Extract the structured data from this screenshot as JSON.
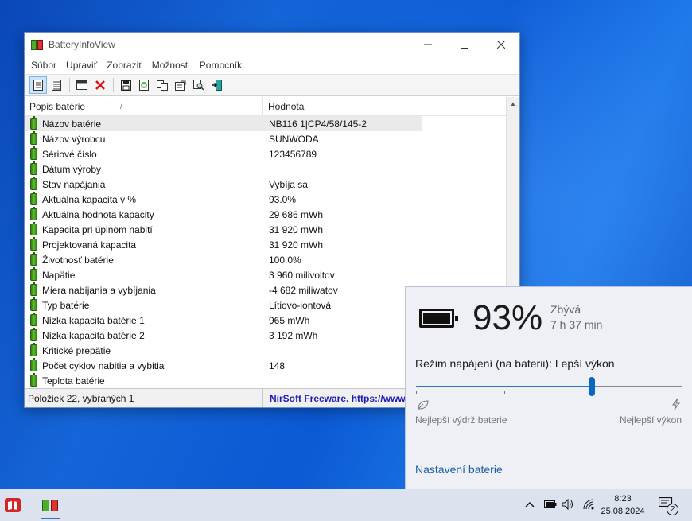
{
  "window": {
    "title": "BatteryInfoView",
    "menu": [
      "Súbor",
      "Upraviť",
      "Zobraziť",
      "Možnosti",
      "Pomocník"
    ],
    "columns": {
      "name": "Popis batérie",
      "value": "Hodnota"
    },
    "rows": [
      {
        "name": "Názov batérie",
        "value": "NB116 1|CP4/58/145-2"
      },
      {
        "name": "Názov výrobcu",
        "value": "SUNWODA"
      },
      {
        "name": "Sériové číslo",
        "value": "123456789"
      },
      {
        "name": "Dátum výroby",
        "value": ""
      },
      {
        "name": "Stav napájania",
        "value": "Vybíja sa"
      },
      {
        "name": "Aktuálna kapacita v %",
        "value": "93.0%"
      },
      {
        "name": "Aktuálna hodnota kapacity",
        "value": "29 686 mWh"
      },
      {
        "name": "Kapacita pri úplnom nabití",
        "value": "31 920 mWh"
      },
      {
        "name": "Projektovaná kapacita",
        "value": "31 920 mWh"
      },
      {
        "name": "Životnosť batérie",
        "value": "100.0%"
      },
      {
        "name": "Napätie",
        "value": "3 960 milivoltov"
      },
      {
        "name": "Miera nabíjania a vybíjania",
        "value": "-4 682 miliwatov"
      },
      {
        "name": "Typ batérie",
        "value": "Lítiovo-iontová"
      },
      {
        "name": "Nízka kapacita batérie 1",
        "value": "965 mWh"
      },
      {
        "name": "Nízka kapacita batérie 2",
        "value": "3 192 mWh"
      },
      {
        "name": "Kritické prepätie",
        "value": ""
      },
      {
        "name": "Počet cyklov nabitia a vybitia",
        "value": "148"
      },
      {
        "name": "Teplota batérie",
        "value": ""
      }
    ],
    "status": {
      "count": "Položiek 22, vybraných 1",
      "freeware": "NirSoft Freeware. https://www.nirsoft.net"
    }
  },
  "flyout": {
    "percent": "93%",
    "remaining_label": "Zbývá",
    "remaining": "7 h 37 min",
    "mode": "Režim napájení (na baterii): Lepší výkon",
    "slider_level": 0.66,
    "left_label": "Nejlepší výdrž baterie",
    "right_label": "Nejlepší výkon",
    "link": "Nastavení baterie"
  },
  "taskbar": {
    "time": "8:23",
    "date": "25.08.2024",
    "notifications": "2"
  },
  "colors": {
    "accent": "#0a66c2",
    "link": "#1a5fa8",
    "freeware_text": "#1a1ab8"
  }
}
